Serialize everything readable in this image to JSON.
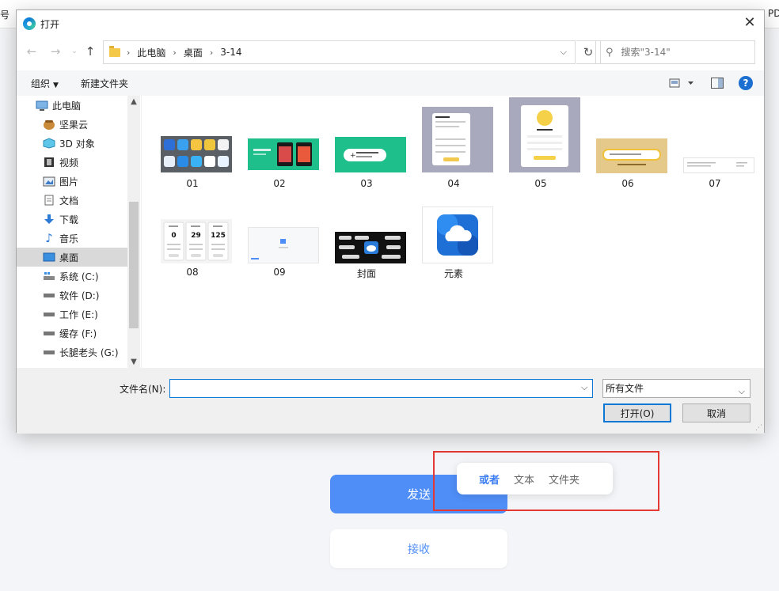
{
  "background": {
    "strip_fragments": [
      "号",
      "PD"
    ],
    "send_label": "发送",
    "receive_label": "接收",
    "popover": {
      "options": [
        "或者",
        "文本",
        "文件夹"
      ]
    }
  },
  "dialog": {
    "title": "打开",
    "breadcrumb": [
      "此电脑",
      "桌面",
      "3-14"
    ],
    "search_placeholder": "搜索\"3-14\"",
    "commands": {
      "organize": "组织",
      "new_folder": "新建文件夹",
      "help": "?"
    },
    "nav": [
      {
        "label": "此电脑",
        "icon": "computer-icon"
      },
      {
        "label": "坚果云",
        "icon": "nut-cloud-icon"
      },
      {
        "label": "3D 对象",
        "icon": "cube-icon"
      },
      {
        "label": "视频",
        "icon": "film-icon"
      },
      {
        "label": "图片",
        "icon": "picture-icon"
      },
      {
        "label": "文档",
        "icon": "document-icon"
      },
      {
        "label": "下载",
        "icon": "download-icon"
      },
      {
        "label": "音乐",
        "icon": "music-icon"
      },
      {
        "label": "桌面",
        "icon": "desktop-icon",
        "selected": true
      },
      {
        "label": "系统 (C:)",
        "icon": "system-drive-icon"
      },
      {
        "label": "软件 (D:)",
        "icon": "drive-icon"
      },
      {
        "label": "工作 (E:)",
        "icon": "drive-icon"
      },
      {
        "label": "缓存 (F:)",
        "icon": "drive-icon"
      },
      {
        "label": "长腿老头 (G:)",
        "icon": "drive-icon"
      }
    ],
    "files": [
      {
        "name": "01",
        "icon": "app-icons-grid-thumbnail"
      },
      {
        "name": "02",
        "icon": "green-cards-thumbnail"
      },
      {
        "name": "03",
        "icon": "green-button-thumbnail"
      },
      {
        "name": "04",
        "icon": "form-card-thumbnail"
      },
      {
        "name": "05",
        "icon": "yellow-avatar-card-thumbnail"
      },
      {
        "name": "06",
        "icon": "yellow-input-thumbnail"
      },
      {
        "name": "07",
        "icon": "white-list-thumbnail"
      },
      {
        "name": "08",
        "icon": "stats-cards-thumbnail"
      },
      {
        "name": "09",
        "icon": "blank-page-thumbnail"
      },
      {
        "name": "封面",
        "icon": "dark-cover-thumbnail"
      },
      {
        "name": "元素",
        "icon": "blue-cloud-app-icon"
      }
    ],
    "stats_sample": [
      "0",
      "29",
      "125"
    ],
    "file_name_label": "文件名(N):",
    "file_name_value": "",
    "file_type": "所有文件",
    "open_label": "打开(O)",
    "cancel_label": "取消"
  },
  "colors": {
    "accent": "#4f8ef7",
    "win_blue": "#0a78d4",
    "highlight": "#e53935"
  }
}
